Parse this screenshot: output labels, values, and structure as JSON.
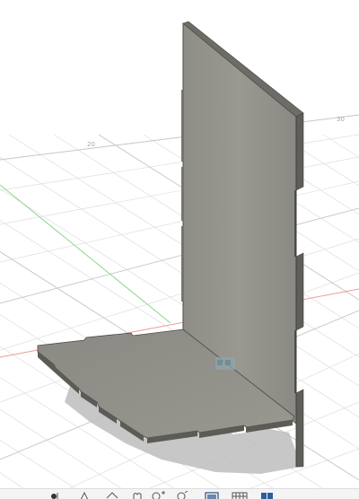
{
  "viewport": {
    "grid_labels": [
      "20",
      "30"
    ],
    "background": "#ffffff",
    "grid_color": "#d9d9d9",
    "axis_x_color": "#e88c8c",
    "axis_y_color": "#7ccf7c",
    "part_face_color": "#8c8b84",
    "part_edge_color": "#3e3e3a"
  },
  "toolbar": {
    "icons": [
      "orbit-icon",
      "look-at-icon",
      "pan-icon",
      "zoom-icon",
      "fit-icon",
      "display-style-icon",
      "grid-settings-icon",
      "viewports-icon"
    ]
  }
}
